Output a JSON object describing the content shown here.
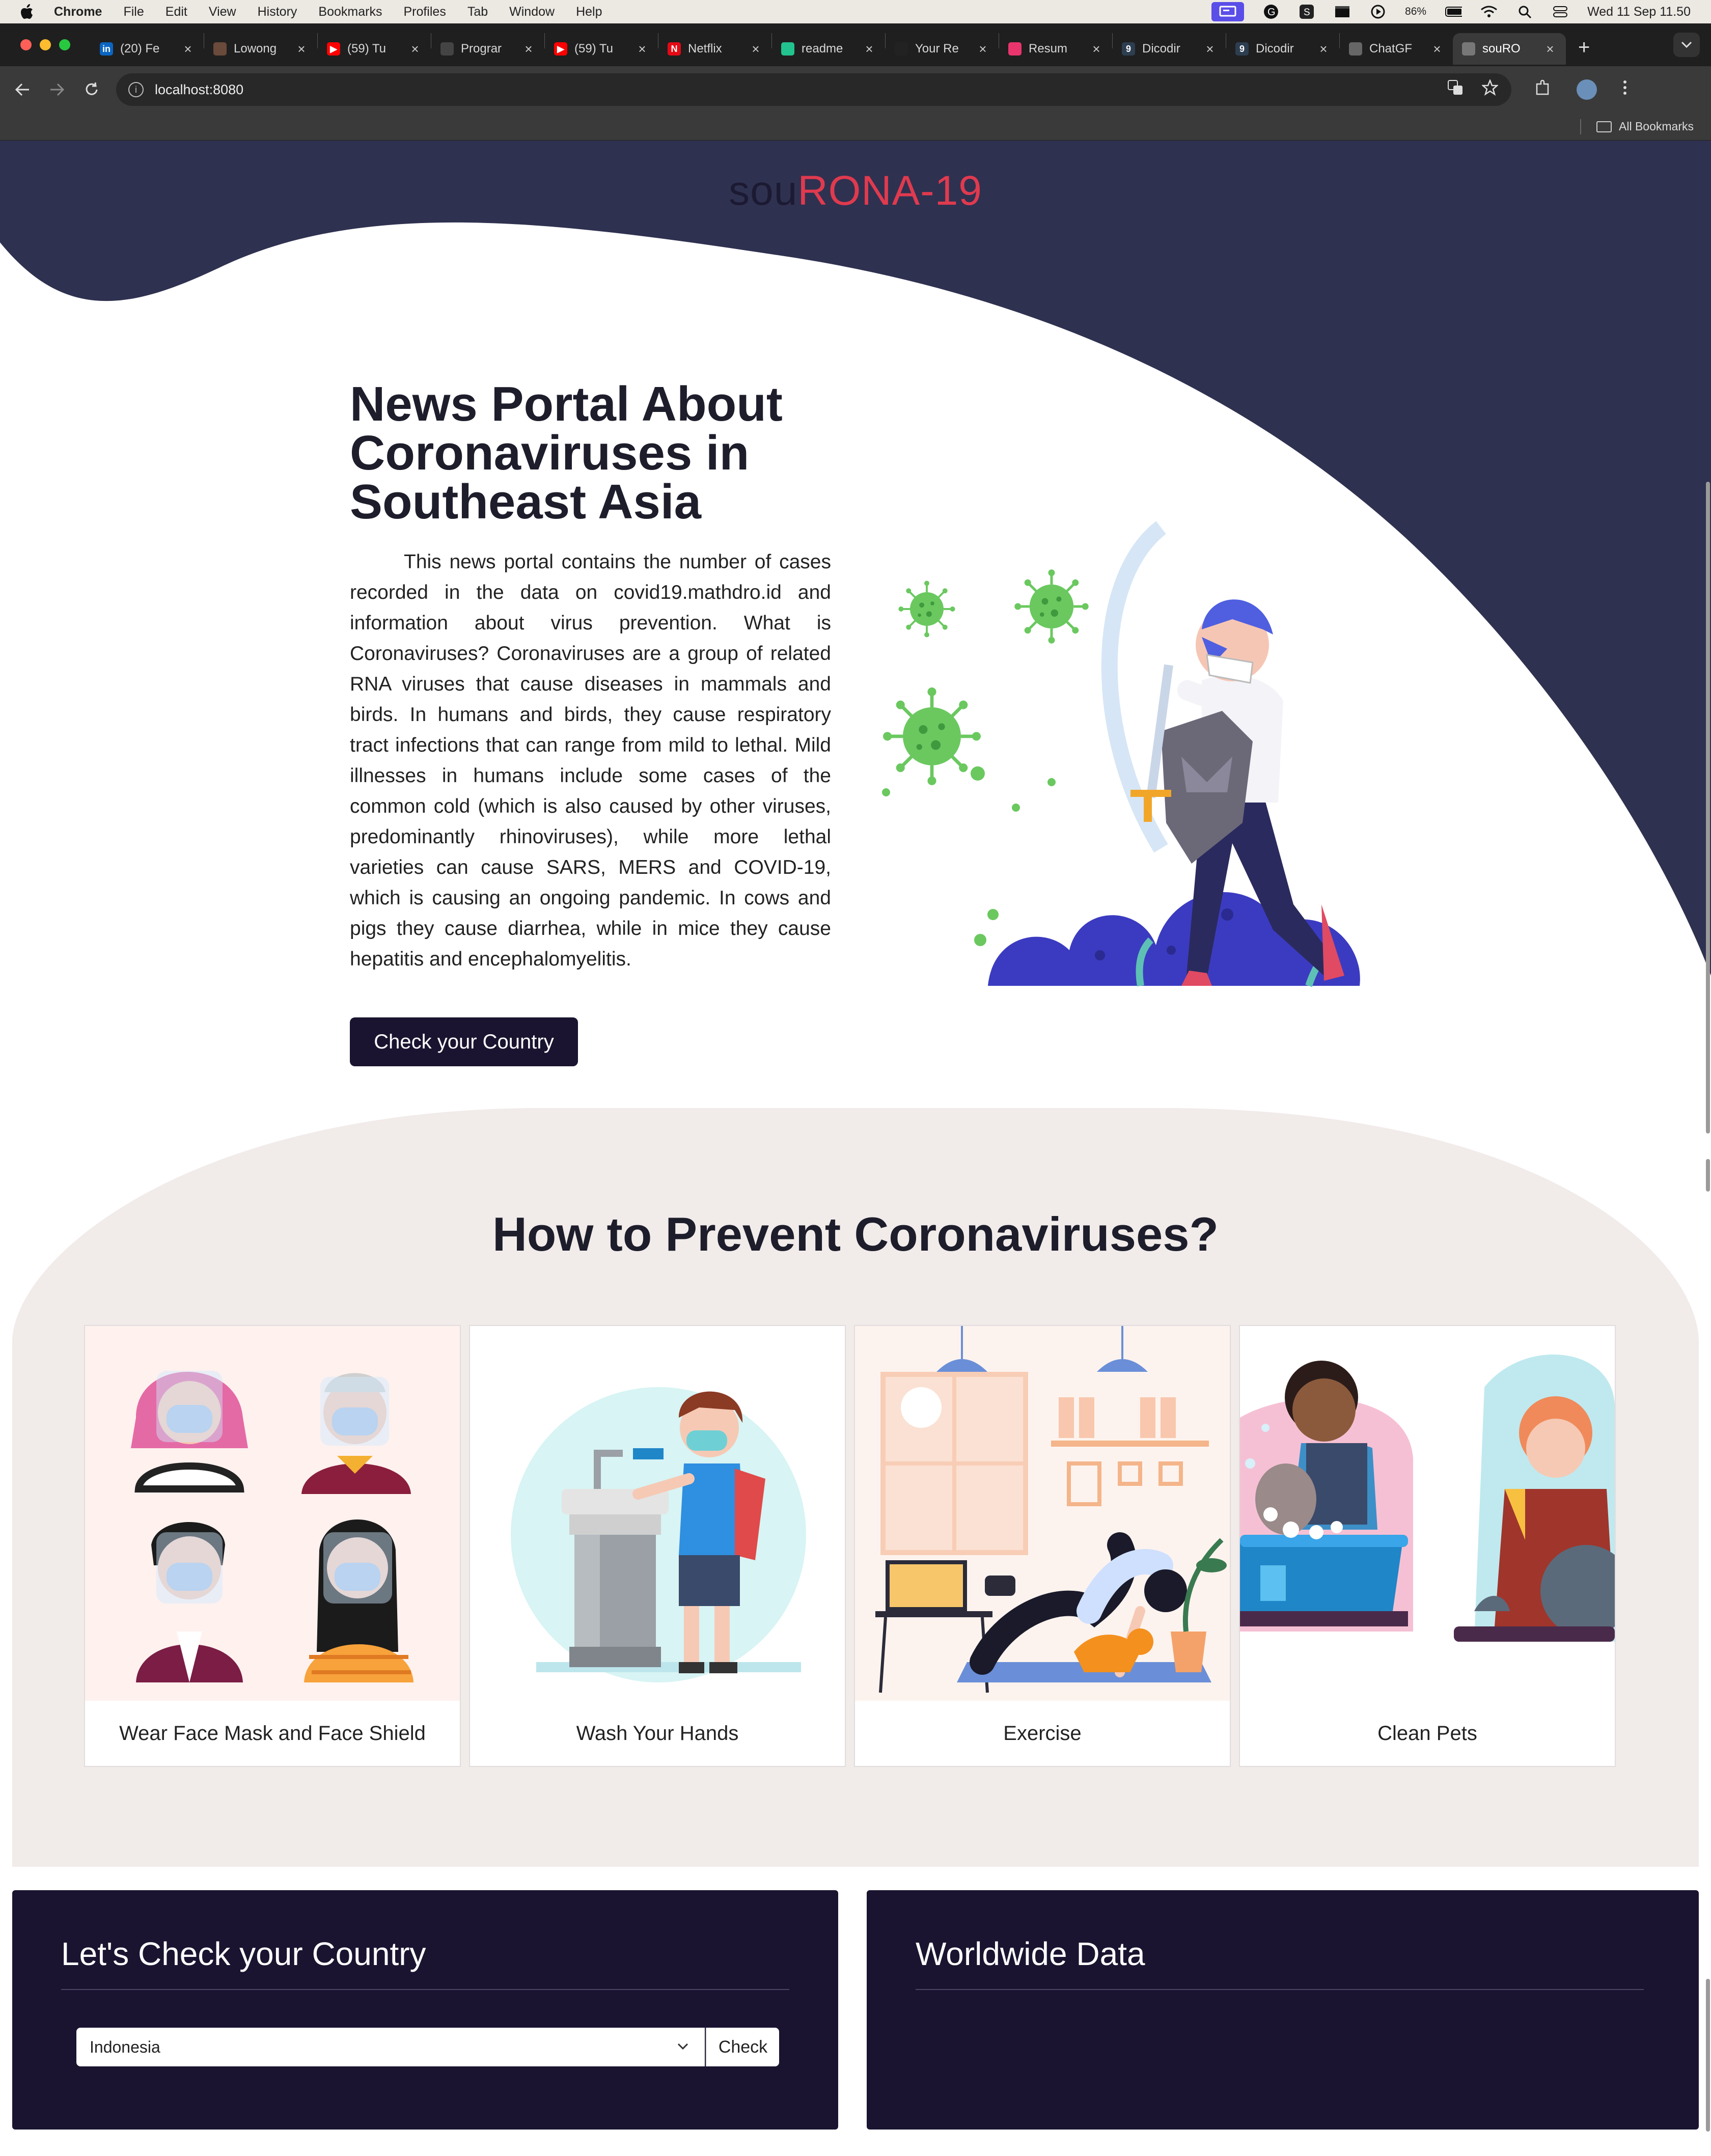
{
  "menubar": {
    "app": "Chrome",
    "items": [
      "File",
      "Edit",
      "View",
      "History",
      "Bookmarks",
      "Profiles",
      "Tab",
      "Window",
      "Help"
    ],
    "battery": "86%",
    "clock": "Wed 11 Sep  11.50"
  },
  "tabs": [
    {
      "title": "(20) Fe",
      "favicon_color": "#0a66c2",
      "favicon_char": "in"
    },
    {
      "title": "Lowong",
      "favicon_color": "#6a4a3a",
      "favicon_char": ""
    },
    {
      "title": "(59) Tu",
      "favicon_color": "#ff0000",
      "favicon_char": "▶"
    },
    {
      "title": "Prograr",
      "favicon_color": "#444444",
      "favicon_char": ""
    },
    {
      "title": "(59) Tu",
      "favicon_color": "#ff0000",
      "favicon_char": "▶"
    },
    {
      "title": "Netflix",
      "favicon_color": "#e50914",
      "favicon_char": "N"
    },
    {
      "title": "readme",
      "favicon_color": "#22c38e",
      "favicon_char": ""
    },
    {
      "title": "Your Re",
      "favicon_color": "#222222",
      "favicon_char": ""
    },
    {
      "title": "Resum",
      "favicon_color": "#e8356d",
      "favicon_char": ""
    },
    {
      "title": "Dicodir",
      "favicon_color": "#2d3e50",
      "favicon_char": "9"
    },
    {
      "title": "Dicodir",
      "favicon_color": "#2d3e50",
      "favicon_char": "9"
    },
    {
      "title": "ChatGF",
      "favicon_color": "#666666",
      "favicon_char": ""
    },
    {
      "title": "souRO",
      "favicon_color": "#777777",
      "favicon_char": "",
      "active": true
    }
  ],
  "address": {
    "url": "localhost:8080"
  },
  "bookmarks": {
    "all_label": "All Bookmarks"
  },
  "site": {
    "brand_prefix": "sou",
    "brand_accent": "RONA-19",
    "hero_title": "News Portal About Coronaviruses in Southeast Asia",
    "hero_text": "This news portal contains the number of cases recorded in the data on covid19.mathdro.id and information about virus prevention. What is Coronaviruses? Coronaviruses are a group of related RNA viruses that cause diseases in mammals and birds. In humans and birds, they cause respiratory tract infections that can range from mild to lethal. Mild illnesses in humans include some cases of the common cold (which is also caused by other viruses, predominantly rhinoviruses), while more lethal varieties can cause SARS, MERS and COVID-19, which is causing an ongoing pandemic. In cows and pigs they cause diarrhea, while in mice they cause hepatitis and encephalomyelitis.",
    "hero_button": "Check your Country",
    "prevent_title": "How to Prevent Coronaviruses?",
    "cards": [
      {
        "label": "Wear Face Mask and Face Shield"
      },
      {
        "label": "Wash Your Hands"
      },
      {
        "label": "Exercise"
      },
      {
        "label": "Clean Pets"
      }
    ],
    "country_panel": {
      "title": "Let's Check your Country",
      "selected": "Indonesia",
      "button": "Check"
    },
    "world_panel": {
      "title": "Worldwide Data"
    }
  },
  "colors": {
    "navy_wave": "#2f3150",
    "accent": "#e03a4f",
    "dark_panel": "#1a1430",
    "section_bg": "#f1ebea",
    "virus_green": "#59c35a"
  }
}
